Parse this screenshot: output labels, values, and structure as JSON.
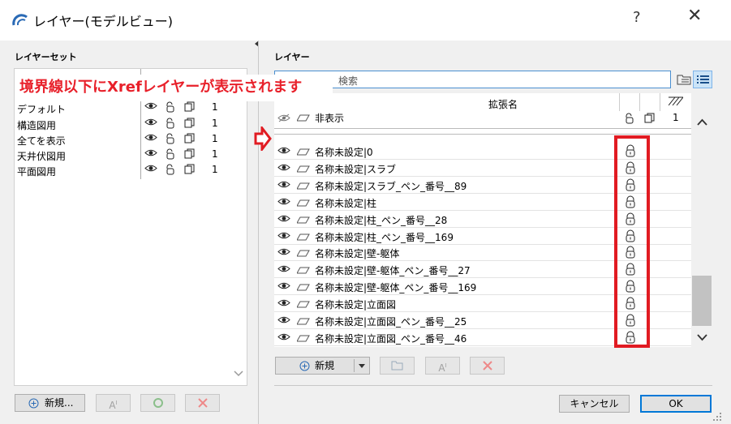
{
  "window": {
    "title": "レイヤー(モデルビュー)",
    "help": "?",
    "close": "✕"
  },
  "left": {
    "header": "レイヤーセット",
    "items": [
      {
        "name": "デフォルト",
        "num": "1"
      },
      {
        "name": "構造図用",
        "num": "1"
      },
      {
        "name": "全てを表示",
        "num": "1"
      },
      {
        "name": "天井伏図用",
        "num": "1"
      },
      {
        "name": "平面図用",
        "num": "1"
      }
    ],
    "new_button": "新規...",
    "new_icon": "plus-circle-icon"
  },
  "right": {
    "header": "レイヤー",
    "search_placeholder": "検索",
    "col_extension": "拡張名",
    "col_pen": "1",
    "hidden_row": "非表示",
    "layers": [
      "名称未設定|0",
      "名称未設定|スラブ",
      "名称未設定|スラブ_ペン_番号__89",
      "名称未設定|柱",
      "名称未設定|柱_ペン_番号__28",
      "名称未設定|柱_ペン_番号__169",
      "名称未設定|壁-躯体",
      "名称未設定|壁-躯体_ペン_番号__27",
      "名称未設定|壁-躯体_ペン_番号__169",
      "名称未設定|立面図",
      "名称未設定|立面図_ペン_番号__25",
      "名称未設定|立面図_ペン_番号__46"
    ],
    "new_button": "新規"
  },
  "annotation": {
    "text": "境界線以下にXrefレイヤーが表示されます",
    "color": "#e8202a"
  },
  "footer": {
    "cancel": "キャンセル",
    "ok": "OK"
  }
}
